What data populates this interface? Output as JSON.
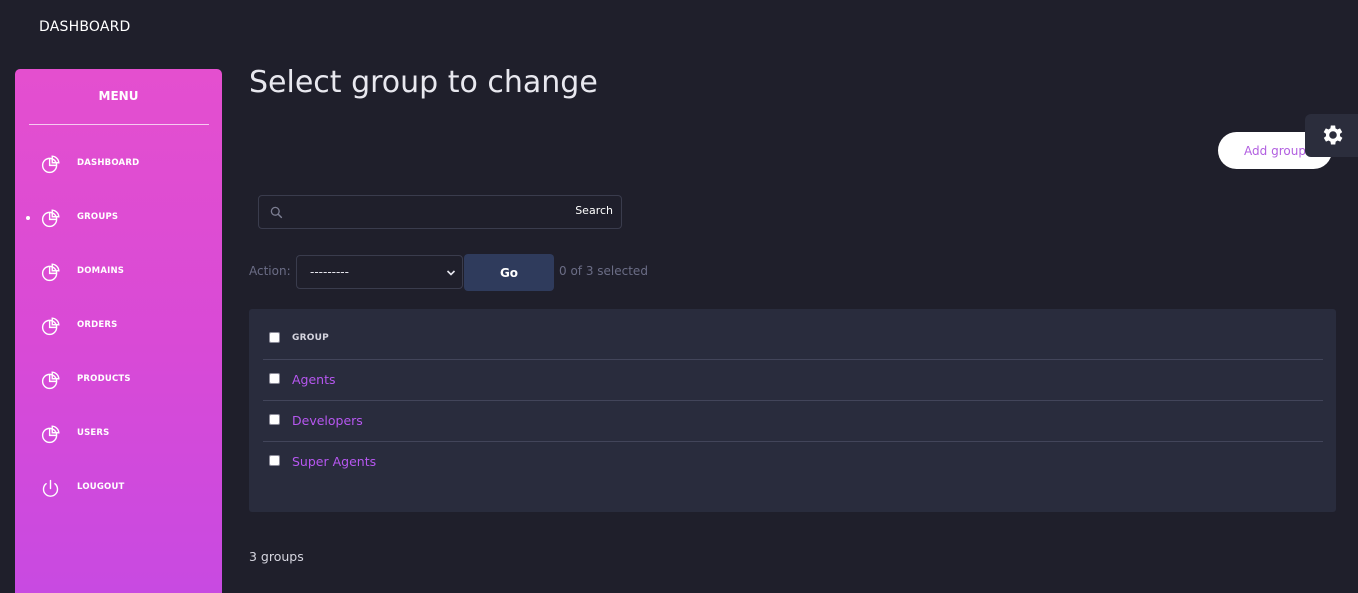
{
  "topbar": {
    "title": "DASHBOARD"
  },
  "sidebar": {
    "heading": "MENU",
    "items": [
      {
        "label": "DASHBOARD",
        "icon": "pie-chart-icon",
        "active": false
      },
      {
        "label": "GROUPS",
        "icon": "pie-chart-icon",
        "active": true
      },
      {
        "label": "DOMAINS",
        "icon": "pie-chart-icon",
        "active": false
      },
      {
        "label": "ORDERS",
        "icon": "pie-chart-icon",
        "active": false
      },
      {
        "label": "PRODUCTS",
        "icon": "pie-chart-icon",
        "active": false
      },
      {
        "label": "USERS",
        "icon": "pie-chart-icon",
        "active": false
      },
      {
        "label": "LOUGOUT",
        "icon": "power-icon",
        "active": false
      }
    ]
  },
  "main": {
    "title": "Select group to change",
    "add_button": "Add group",
    "search": {
      "placeholder": "",
      "value": "",
      "button": "Search"
    },
    "actions": {
      "label": "Action:",
      "selected": "---------",
      "go_button": "Go",
      "selection_count": "0 of 3 selected"
    },
    "table": {
      "column_header": "GROUP",
      "rows": [
        "Agents",
        "Developers",
        "Super Agents"
      ]
    },
    "result_count": "3 groups"
  },
  "colors": {
    "background": "#1f1f2b",
    "sidebar_gradient_start": "#e44fcf",
    "sidebar_gradient_end": "#c74ae2",
    "link": "#b657f0",
    "panel": "#292c3d",
    "go_button": "#2f3b5c"
  },
  "icons": {
    "settings": "gear-icon",
    "search": "search-icon",
    "select": "chevron-down-icon"
  }
}
